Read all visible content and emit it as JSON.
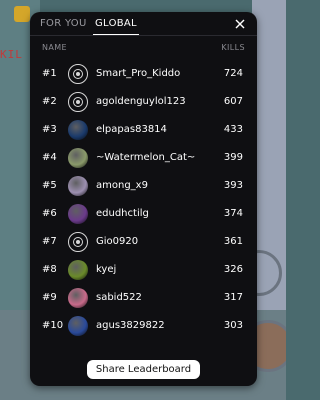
{
  "tabs": [
    {
      "label": "FOR YOU",
      "active": false
    },
    {
      "label": "GLOBAL",
      "active": true
    }
  ],
  "header": {
    "name_label": "NAME",
    "kills_label": "KILLS"
  },
  "rows": [
    {
      "rank": "#1",
      "name": "Smart_Pro_Kiddo",
      "kills": "724",
      "avatar": "ring-avatar-icon",
      "color": "#0f0f12"
    },
    {
      "rank": "#2",
      "name": "agoldenguylol123",
      "kills": "607",
      "avatar": "ring-avatar-icon",
      "color": "#0f0f12"
    },
    {
      "rank": "#3",
      "name": "elpapas83814",
      "kills": "433",
      "avatar": "photo-avatar-icon",
      "color": "#1a3a6b"
    },
    {
      "rank": "#4",
      "name": "~Watermelon_Cat~",
      "kills": "399",
      "avatar": "photo-avatar-icon",
      "color": "#8a9a6a"
    },
    {
      "rank": "#5",
      "name": "among_x9",
      "kills": "393",
      "avatar": "photo-avatar-icon",
      "color": "#9c8fb0"
    },
    {
      "rank": "#6",
      "name": "edudhctilg",
      "kills": "374",
      "avatar": "photo-avatar-icon",
      "color": "#6a3a8a"
    },
    {
      "rank": "#7",
      "name": "Gio0920",
      "kills": "361",
      "avatar": "ring-avatar-icon",
      "color": "#0f0f12"
    },
    {
      "rank": "#8",
      "name": "kyej",
      "kills": "326",
      "avatar": "photo-avatar-icon",
      "color": "#6a8a2a"
    },
    {
      "rank": "#9",
      "name": "sabid522",
      "kills": "317",
      "avatar": "photo-avatar-icon",
      "color": "#c86a8a"
    },
    {
      "rank": "#10",
      "name": "agus3829822",
      "kills": "303",
      "avatar": "photo-avatar-icon",
      "color": "#2a4a9a"
    }
  ],
  "share_button": {
    "label": "Share Leaderboard"
  },
  "background": {
    "kill_text": "KIL"
  }
}
